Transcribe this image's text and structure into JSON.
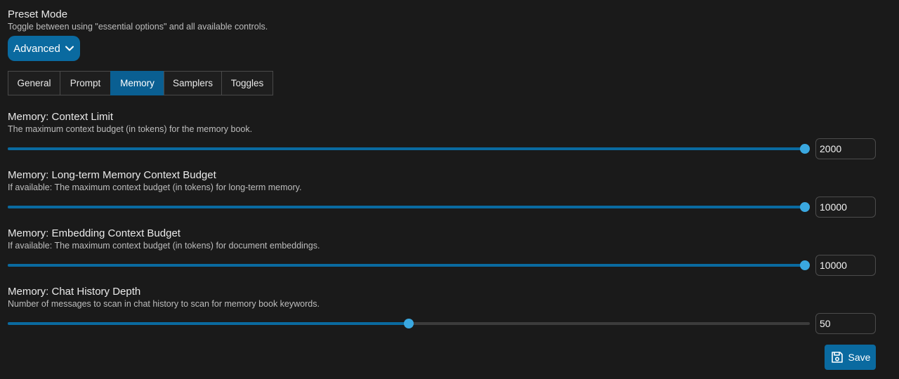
{
  "preset": {
    "title": "Preset Mode",
    "description": "Toggle between using \"essential options\" and all available controls.",
    "selected": "Advanced"
  },
  "tabs": [
    {
      "label": "General",
      "active": false
    },
    {
      "label": "Prompt",
      "active": false
    },
    {
      "label": "Memory",
      "active": true
    },
    {
      "label": "Samplers",
      "active": false
    },
    {
      "label": "Toggles",
      "active": false
    }
  ],
  "settings": [
    {
      "title": "Memory: Context Limit",
      "description": "The maximum context budget (in tokens) for the memory book.",
      "value": "2000",
      "slider_fraction": 1.0
    },
    {
      "title": "Memory: Long-term Memory Context Budget",
      "description": "If available: The maximum context budget (in tokens) for long-term memory.",
      "value": "10000",
      "slider_fraction": 1.0
    },
    {
      "title": "Memory: Embedding Context Budget",
      "description": "If available: The maximum context budget (in tokens) for document embeddings.",
      "value": "10000",
      "slider_fraction": 1.0
    },
    {
      "title": "Memory: Chat History Depth",
      "description": "Number of messages to scan in chat history to scan for memory book keywords.",
      "value": "50",
      "slider_fraction": 0.5
    }
  ],
  "save_label": "Save",
  "colors": {
    "accent": "#0a6aa0",
    "thumb": "#3aa8e0",
    "background": "#1a1a1a"
  }
}
